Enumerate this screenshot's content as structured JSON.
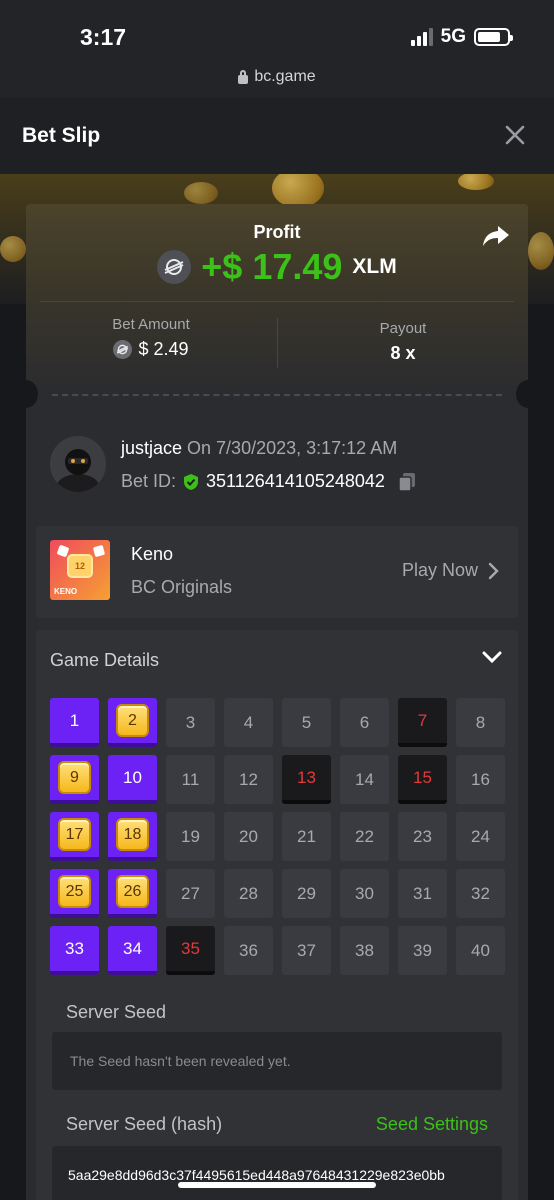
{
  "status_bar": {
    "time": "3:17",
    "network": "5G"
  },
  "browser": {
    "url": "bc.game"
  },
  "header": {
    "title": "Bet Slip"
  },
  "result": {
    "profit_label": "Profit",
    "profit_amount": "+$ 17.49",
    "currency": "XLM",
    "bet_amount_label": "Bet Amount",
    "bet_amount": "$ 2.49",
    "payout_label": "Payout",
    "payout": "8 x"
  },
  "bet_info": {
    "username": "justjace",
    "date_text": " On 7/30/2023, 3:17:12 AM",
    "bet_id_label": "Bet ID:",
    "bet_id": "351126414105248042"
  },
  "game": {
    "thumb_number": "12",
    "thumb_label": "KENO",
    "name": "Keno",
    "provider": "BC Originals",
    "play_label": "Play Now"
  },
  "details": {
    "title": "Game Details",
    "tiles": [
      {
        "n": "1",
        "s": "sel"
      },
      {
        "n": "2",
        "s": "hit"
      },
      {
        "n": "3",
        "s": ""
      },
      {
        "n": "4",
        "s": ""
      },
      {
        "n": "5",
        "s": ""
      },
      {
        "n": "6",
        "s": ""
      },
      {
        "n": "7",
        "s": "miss"
      },
      {
        "n": "8",
        "s": ""
      },
      {
        "n": "9",
        "s": "hit"
      },
      {
        "n": "10",
        "s": "sel"
      },
      {
        "n": "11",
        "s": ""
      },
      {
        "n": "12",
        "s": ""
      },
      {
        "n": "13",
        "s": "miss"
      },
      {
        "n": "14",
        "s": ""
      },
      {
        "n": "15",
        "s": "miss"
      },
      {
        "n": "16",
        "s": ""
      },
      {
        "n": "17",
        "s": "hit"
      },
      {
        "n": "18",
        "s": "hit"
      },
      {
        "n": "19",
        "s": ""
      },
      {
        "n": "20",
        "s": ""
      },
      {
        "n": "21",
        "s": ""
      },
      {
        "n": "22",
        "s": ""
      },
      {
        "n": "23",
        "s": ""
      },
      {
        "n": "24",
        "s": ""
      },
      {
        "n": "25",
        "s": "hit"
      },
      {
        "n": "26",
        "s": "hit"
      },
      {
        "n": "27",
        "s": ""
      },
      {
        "n": "28",
        "s": ""
      },
      {
        "n": "29",
        "s": ""
      },
      {
        "n": "30",
        "s": ""
      },
      {
        "n": "31",
        "s": ""
      },
      {
        "n": "32",
        "s": ""
      },
      {
        "n": "33",
        "s": "sel"
      },
      {
        "n": "34",
        "s": "sel"
      },
      {
        "n": "35",
        "s": "miss"
      },
      {
        "n": "36",
        "s": ""
      },
      {
        "n": "37",
        "s": ""
      },
      {
        "n": "38",
        "s": ""
      },
      {
        "n": "39",
        "s": ""
      },
      {
        "n": "40",
        "s": ""
      }
    ],
    "server_seed_label": "Server Seed",
    "server_seed_value": "The Seed hasn't been revealed yet.",
    "server_seed_hash_label": "Server Seed (hash)",
    "seed_settings_label": "Seed Settings",
    "server_seed_hash": "5aa29e8dd96d3c37f4495615ed448a97648431229e823e0bb"
  },
  "colors": {
    "accent_green": "#3bc117",
    "tile_selected": "#6d22f5",
    "tile_miss_text": "#e23a3a",
    "background": "#17181b"
  }
}
